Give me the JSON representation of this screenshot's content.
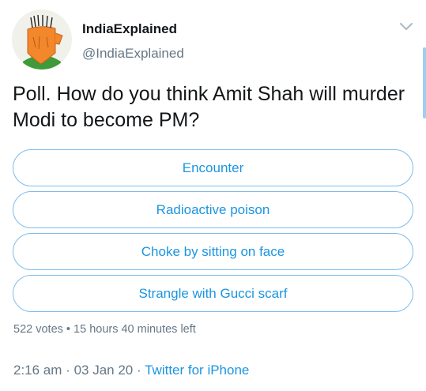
{
  "author": {
    "display_name": "IndiaExplained",
    "handle": "@IndiaExplained"
  },
  "tweet": {
    "text": "Poll. How do you think Amit Shah will murder Modi to become PM?"
  },
  "poll": {
    "options": [
      "Encounter",
      "Radioactive poison",
      "Choke by sitting on face",
      "Strangle with Gucci scarf"
    ],
    "votes": "522 votes",
    "separator": "•",
    "time_left": "15 hours 40 minutes left"
  },
  "meta": {
    "time": "2:16 am",
    "date": "03 Jan 20",
    "separator": "·",
    "source": "Twitter for iPhone"
  },
  "icons": {
    "menu": "chevron-down-icon"
  },
  "colors": {
    "accent": "#1b95e0",
    "option_border": "#7dbcec",
    "secondary_text": "#657786",
    "primary_text": "#14171a"
  }
}
